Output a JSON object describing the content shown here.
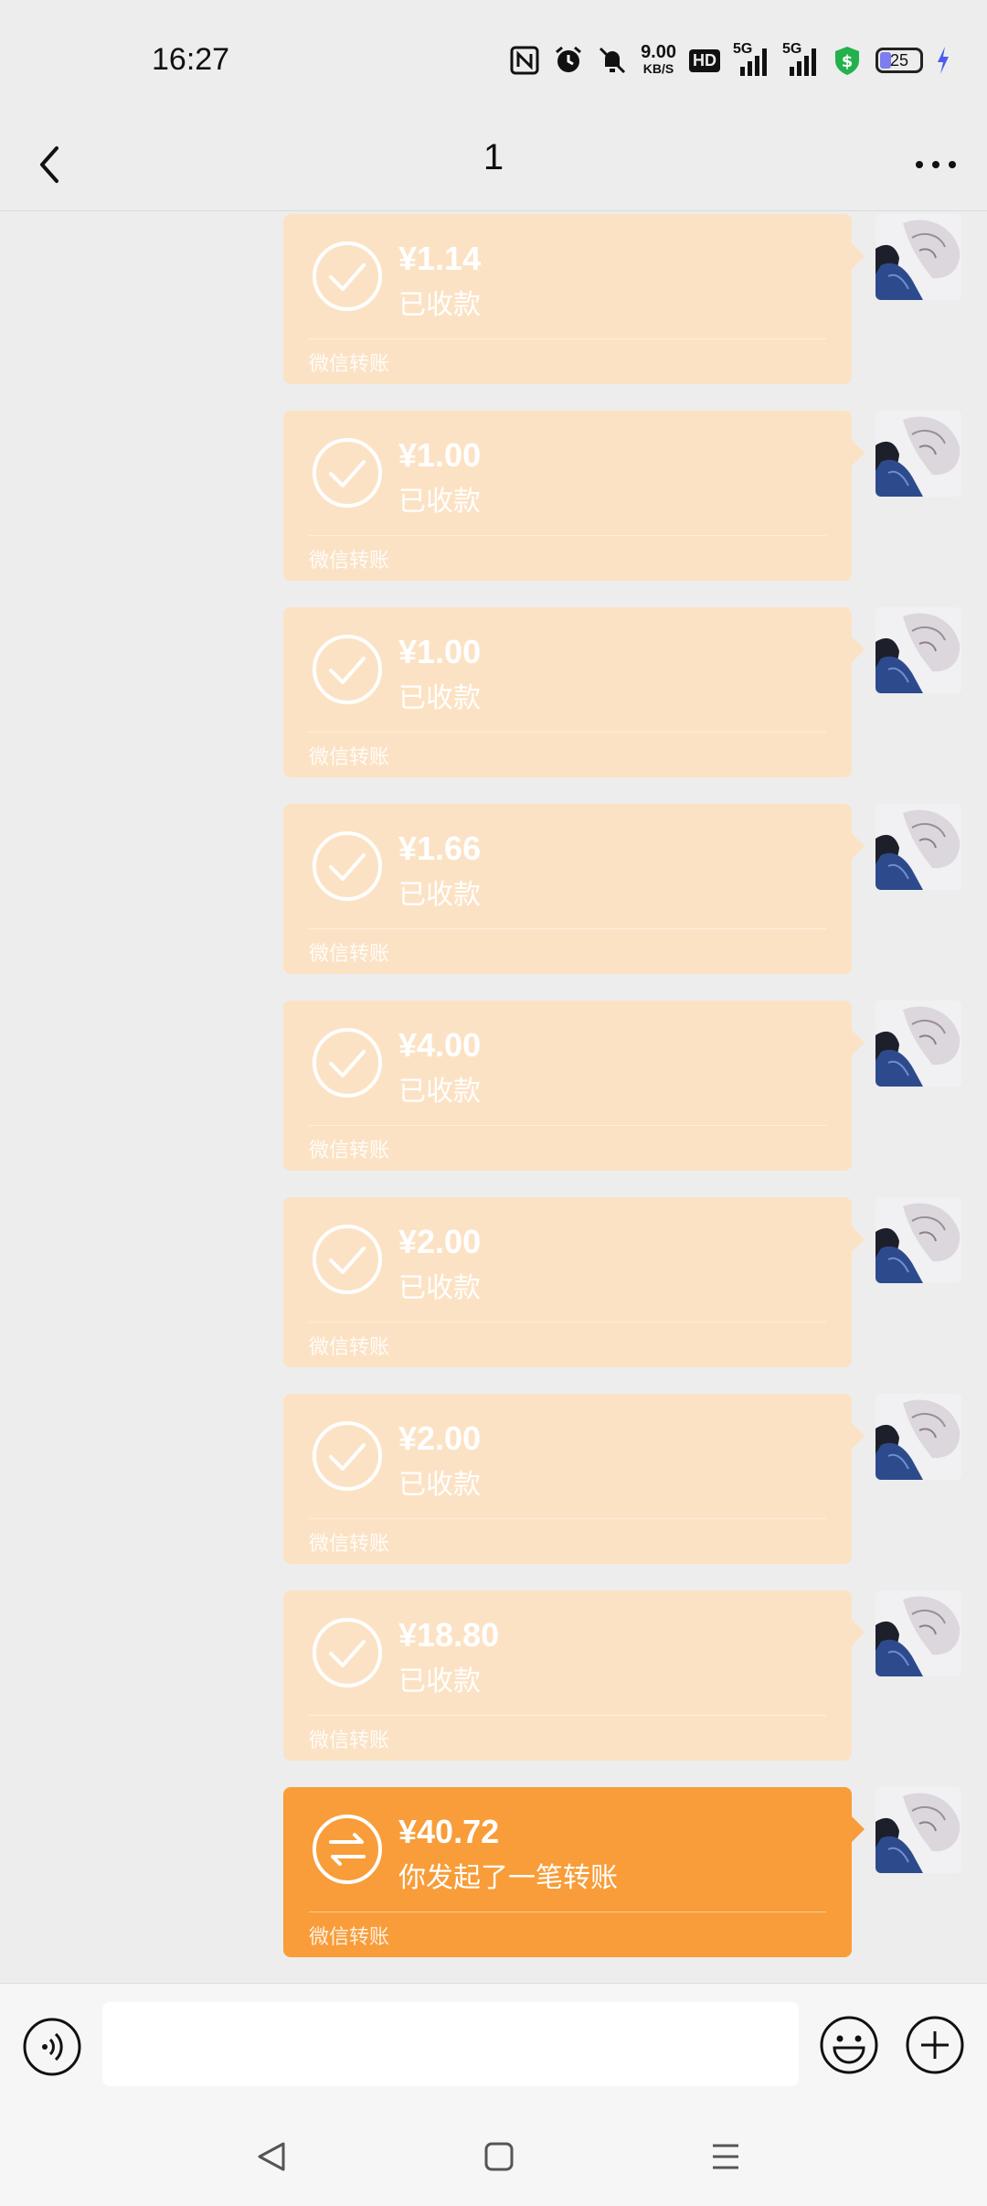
{
  "status_bar": {
    "time": "16:27",
    "net_speed_value": "9.00",
    "net_speed_unit": "KB/S",
    "hd_label": "HD",
    "signal_1": "5G",
    "signal_2": "5G",
    "battery_level": "25"
  },
  "header": {
    "title": "1"
  },
  "messages": [
    {
      "amount": "¥1.14",
      "status": "已收款",
      "footer": "微信转账",
      "state": "received"
    },
    {
      "amount": "¥1.00",
      "status": "已收款",
      "footer": "微信转账",
      "state": "received"
    },
    {
      "amount": "¥1.00",
      "status": "已收款",
      "footer": "微信转账",
      "state": "received"
    },
    {
      "amount": "¥1.66",
      "status": "已收款",
      "footer": "微信转账",
      "state": "received"
    },
    {
      "amount": "¥4.00",
      "status": "已收款",
      "footer": "微信转账",
      "state": "received"
    },
    {
      "amount": "¥2.00",
      "status": "已收款",
      "footer": "微信转账",
      "state": "received"
    },
    {
      "amount": "¥2.00",
      "status": "已收款",
      "footer": "微信转账",
      "state": "received"
    },
    {
      "amount": "¥18.80",
      "status": "已收款",
      "footer": "微信转账",
      "state": "received"
    },
    {
      "amount": "¥40.72",
      "status": "你发起了一笔转账",
      "footer": "微信转账",
      "state": "sent"
    }
  ],
  "input": {
    "value": "",
    "placeholder": ""
  },
  "colors": {
    "received_bubble": "#fce2c4",
    "sent_bubble": "#f89d39",
    "background": "#ededed"
  },
  "icons": {
    "back": "back-icon",
    "more": "more-icon",
    "received": "check-circle-icon",
    "sent": "transfer-arrows-icon",
    "voice": "voice-icon",
    "emoji": "emoji-icon",
    "plus": "plus-icon"
  }
}
